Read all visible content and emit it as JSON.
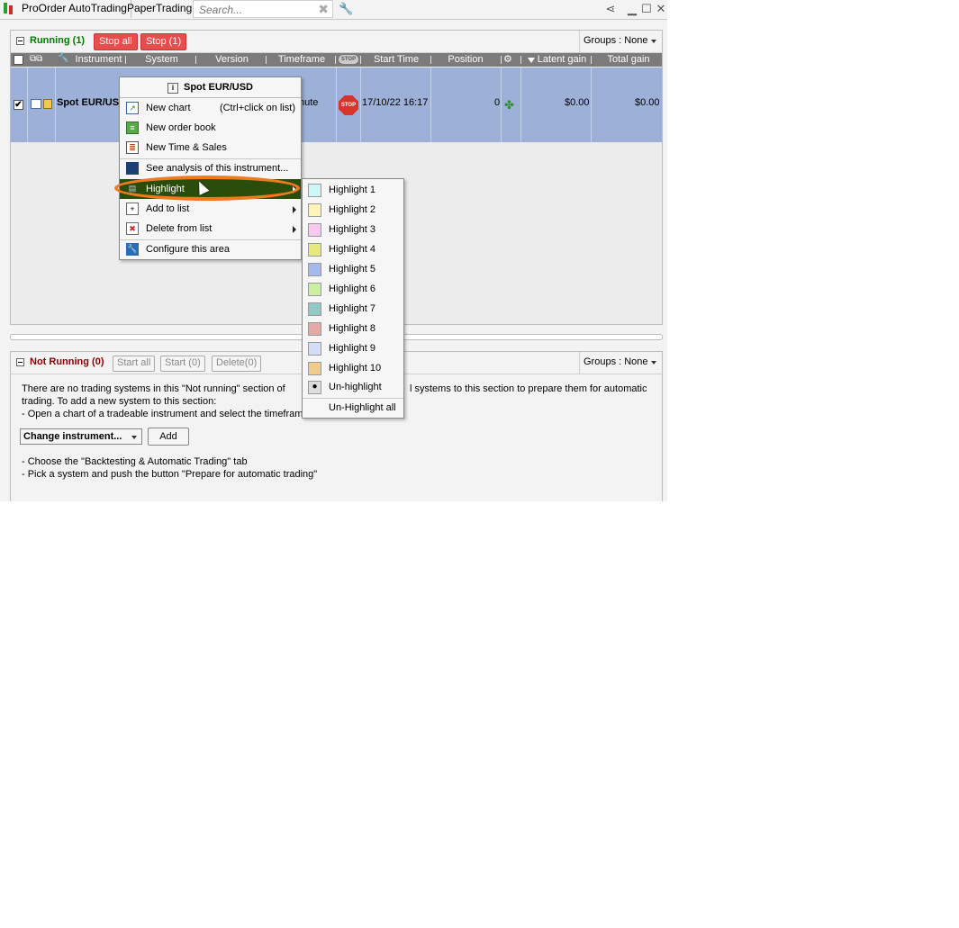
{
  "topbar": {
    "tabs": [
      "ProOrder AutoTrading",
      "PaperTrading"
    ],
    "search_placeholder": "Search...",
    "icons": [
      "candlestick-icon",
      "wrench-icon",
      "share-icon",
      "minimize-icon",
      "maximize-icon",
      "close-icon"
    ]
  },
  "running": {
    "title": "Running (1)",
    "title_color": "#007a00",
    "stop_all": "Stop all",
    "stop_sel": "Stop (1)",
    "groups": "Groups : None",
    "columns": [
      "Instrument",
      "System",
      "Version",
      "Timeframe",
      "Start Time",
      "Position",
      "Latent gain",
      "Total gain"
    ],
    "row": {
      "instrument": "Spot EUR/USD",
      "timeframe": "nute",
      "start_time": "17/10/22 16:17",
      "position": "0",
      "latent_gain": "$0.00",
      "total_gain": "$0.00",
      "selected_color": "#9db1d8"
    }
  },
  "not_running": {
    "title": "Not Running (0)",
    "title_color": "#8b0000",
    "start_all": "Start all",
    "start_sel": "Start (0)",
    "delete_sel": "Delete(0)",
    "groups": "Groups : None",
    "text1a": "There are no trading systems in this \"Not running\" section of",
    "text1b": "l systems to this section to prepare them for automatic",
    "text2": "trading. To add a new system to this section:",
    "text3": "- Open a chart of a tradeable instrument and select the timeframe",
    "change_instrument": "Change instrument...",
    "add": "Add",
    "text4": "- Choose the \"Backtesting & Automatic Trading\" tab",
    "text5": "- Pick a system and push the button \"Prepare for automatic trading\""
  },
  "context_menu": {
    "title": "Spot EUR/USD",
    "items": [
      {
        "label": "New chart",
        "shortcut": "(Ctrl+click on list)",
        "icon": "chart-icon"
      },
      {
        "label": "New order book",
        "icon": "order-book-icon"
      },
      {
        "label": "New Time & Sales",
        "icon": "time-sales-icon"
      },
      {
        "label": "See analysis of this instrument...",
        "icon": "analysis-icon"
      },
      {
        "label": "Highlight",
        "icon": "highlight-icon"
      },
      {
        "label": "Add to list",
        "icon": "add-list-icon"
      },
      {
        "label": "Delete from list",
        "icon": "delete-list-icon"
      },
      {
        "label": "Configure this area",
        "icon": "configure-icon"
      }
    ]
  },
  "highlight_menu": {
    "items": [
      {
        "label": "Highlight 1",
        "color": "#ccf7f5"
      },
      {
        "label": "Highlight 2",
        "color": "#fdf5b8"
      },
      {
        "label": "Highlight 3",
        "color": "#f8c8ef"
      },
      {
        "label": "Highlight 4",
        "color": "#e6ea7a"
      },
      {
        "label": "Highlight 5",
        "color": "#a5b9ec"
      },
      {
        "label": "Highlight 6",
        "color": "#c9ef9f"
      },
      {
        "label": "Highlight 7",
        "color": "#92c9c3"
      },
      {
        "label": "Highlight 8",
        "color": "#e4aaa6"
      },
      {
        "label": "Highlight 9",
        "color": "#d4ddf5"
      },
      {
        "label": "Highlight 10",
        "color": "#efcb8c"
      }
    ],
    "unhighlight": "Un-highlight",
    "unhighlight_all": "Un-Highlight all"
  }
}
